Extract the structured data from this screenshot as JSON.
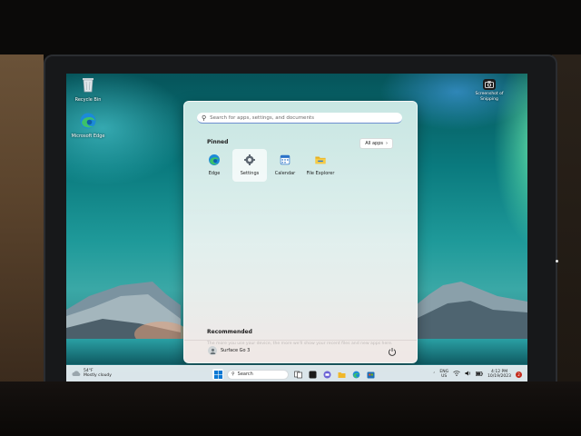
{
  "desktop": {
    "icons": [
      {
        "label": "Recycle Bin"
      },
      {
        "label": "Microsoft Edge"
      }
    ],
    "snip_shortcut": {
      "label_line1": "Screenshot of",
      "label_line2": "Snipping"
    }
  },
  "start_menu": {
    "search_placeholder": "Search for apps, settings, and documents",
    "pinned_title": "Pinned",
    "all_apps_label": "All apps",
    "pinned_apps": [
      {
        "label": "Edge"
      },
      {
        "label": "Settings"
      },
      {
        "label": "Calendar"
      },
      {
        "label": "File Explorer"
      }
    ],
    "recommended_title": "Recommended",
    "recommended_text": "The more you use your device, the more we'll show your recent files and new apps here.",
    "user_name": "Surface Go 3"
  },
  "taskbar": {
    "weather_temp": "54°F",
    "weather_desc": "Mostly cloudy",
    "search_label": "Search",
    "tray_lang_line1": "ENG",
    "tray_lang_line2": "US",
    "clock_time": "4:12 PM",
    "clock_date": "10/19/2023",
    "notification_count": "2"
  },
  "colors": {
    "accent": "#0067c0",
    "notification": "#c42b1c"
  }
}
